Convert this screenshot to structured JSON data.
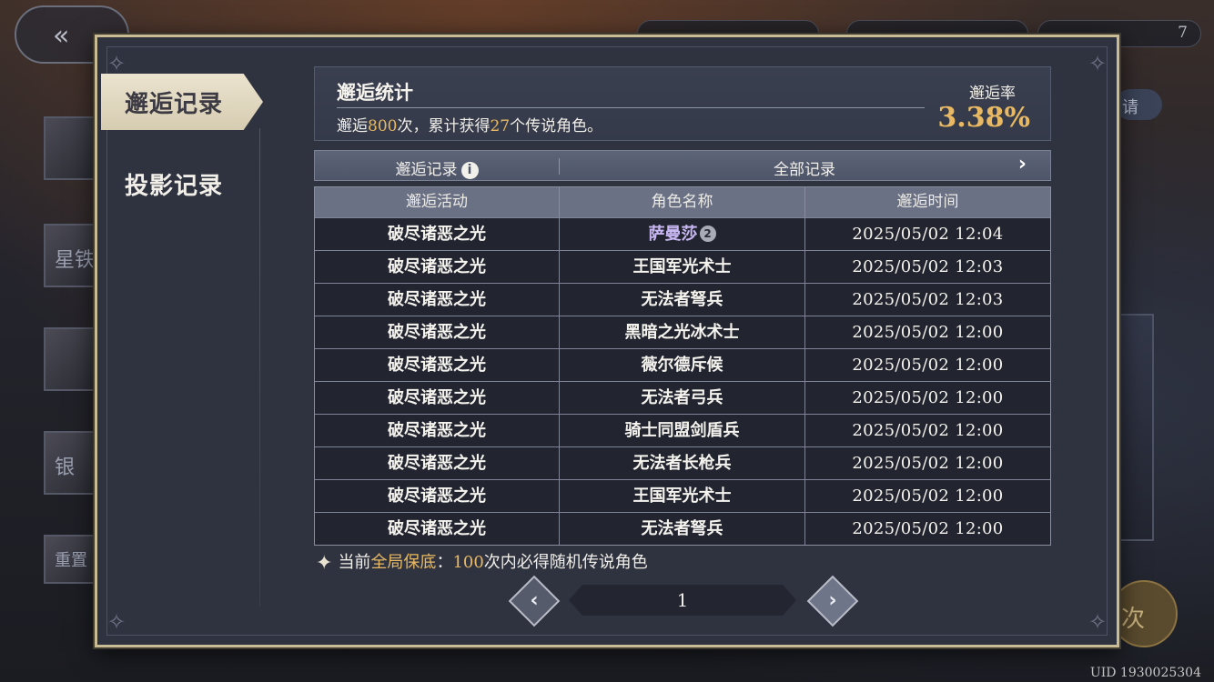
{
  "background": {
    "uid": "UID 1930025304",
    "left_thumb_labels": [
      "星铁",
      "银",
      "重置"
    ],
    "right_pill_label": "请",
    "right_button_label": "次",
    "top_pill_value": "7"
  },
  "dialog": {
    "tabs": [
      {
        "label": "邂逅记录",
        "active": true
      },
      {
        "label": "投影记录",
        "active": false
      }
    ],
    "stats": {
      "title": "邂逅统计",
      "desc_prefix": "邂逅",
      "total_count": "800",
      "desc_mid": "次，累计获得",
      "legend_count": "27",
      "desc_suffix": "个传说角色。",
      "rate_label": "邂逅率",
      "rate_value": "3.38%"
    },
    "records_bar": {
      "label": "邂逅记录",
      "info_icon": "i",
      "filter": "全部记录",
      "arrow": "›"
    },
    "table": {
      "headers": [
        "邂逅活动",
        "角色名称",
        "邂逅时间"
      ],
      "rows": [
        {
          "activity": "破尽诸恶之光",
          "name": "萨曼莎",
          "legend": true,
          "time": "2025/05/02 12:04"
        },
        {
          "activity": "破尽诸恶之光",
          "name": "王国军光术士",
          "legend": false,
          "time": "2025/05/02 12:03"
        },
        {
          "activity": "破尽诸恶之光",
          "name": "无法者弩兵",
          "legend": false,
          "time": "2025/05/02 12:03"
        },
        {
          "activity": "破尽诸恶之光",
          "name": "黑暗之光冰术士",
          "legend": false,
          "time": "2025/05/02 12:00"
        },
        {
          "activity": "破尽诸恶之光",
          "name": "薇尔德斥候",
          "legend": false,
          "time": "2025/05/02 12:00"
        },
        {
          "activity": "破尽诸恶之光",
          "name": "无法者弓兵",
          "legend": false,
          "time": "2025/05/02 12:00"
        },
        {
          "activity": "破尽诸恶之光",
          "name": "骑士同盟剑盾兵",
          "legend": false,
          "time": "2025/05/02 12:00"
        },
        {
          "activity": "破尽诸恶之光",
          "name": "无法者长枪兵",
          "legend": false,
          "time": "2025/05/02 12:00"
        },
        {
          "activity": "破尽诸恶之光",
          "name": "王国军光术士",
          "legend": false,
          "time": "2025/05/02 12:00"
        },
        {
          "activity": "破尽诸恶之光",
          "name": "无法者弩兵",
          "legend": false,
          "time": "2025/05/02 12:00"
        }
      ],
      "legend_badge": "2"
    },
    "note": {
      "prefix": "当前",
      "highlight1": "全局保底",
      "colon": "：",
      "highlight2": "100",
      "suffix": "次内必得随机传说角色"
    },
    "pagination": {
      "prev": "‹",
      "page": "1",
      "next": "›"
    }
  },
  "colors": {
    "accent_gold": "#e8b962",
    "legend_purple": "#c8b7f2",
    "frame_gold": "#c9bb94"
  }
}
